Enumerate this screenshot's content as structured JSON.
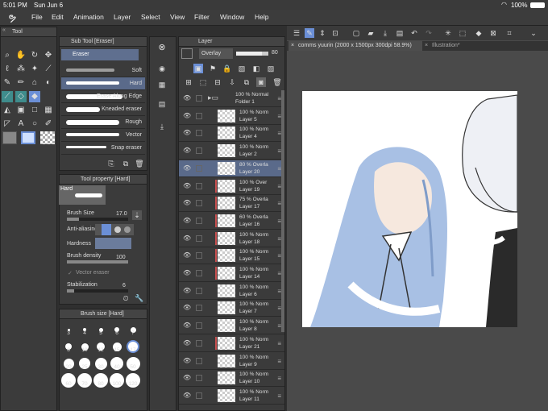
{
  "status": {
    "time": "5:01 PM",
    "date": "Sun Jun 6",
    "battery": "100%"
  },
  "menu": [
    "File",
    "Edit",
    "Animation",
    "Layer",
    "Select",
    "View",
    "Filter",
    "Window",
    "Help"
  ],
  "tool_panel": {
    "title": "Tool"
  },
  "subtool_panel": {
    "title": "Sub Tool [Eraser]",
    "group": "Eraser",
    "items": [
      "Soft",
      "Hard",
      "Erase Along Edge",
      "Kneaded eraser",
      "Rough",
      "Vector",
      "Snap eraser"
    ],
    "selected": "Hard"
  },
  "tool_property": {
    "title": "Tool property [Hard]",
    "preset": "Hard",
    "brush_size_label": "Brush Size",
    "brush_size": "17.0",
    "antialias_label": "Anti-aliasing",
    "hardness_label": "Hardness",
    "density_label": "Brush density",
    "density": "100",
    "vector_eraser_label": "Vector eraser",
    "stabilization_label": "Stabilization",
    "stabilization": "6"
  },
  "brush_size_panel": {
    "title": "Brush size [Hard]",
    "sizes": [
      "3",
      "4",
      "5",
      "6",
      "7",
      "8",
      "10",
      "12",
      "15",
      "17",
      "20",
      "25",
      "30",
      "40",
      "50",
      "60",
      "70",
      "80",
      "100",
      "120"
    ],
    "selected": "17"
  },
  "layer_panel": {
    "title": "Layer",
    "blend_mode": "Overlay",
    "opacity": "80",
    "layers": [
      {
        "mode": "100 % Normal",
        "name": "Folder 1",
        "folder": true
      },
      {
        "mode": "100 % Norm",
        "name": "Layer 5"
      },
      {
        "mode": "100 % Norm",
        "name": "Layer 4"
      },
      {
        "mode": "100 % Norm",
        "name": "Layer 2"
      },
      {
        "mode": "80 % Overla",
        "name": "Layer 20",
        "selected": true
      },
      {
        "mode": "100 % Over",
        "name": "Layer 19",
        "clip": true
      },
      {
        "mode": "75 % Overla",
        "name": "Layer 17",
        "clip": true
      },
      {
        "mode": "60 % Overla",
        "name": "Layer 16",
        "clip": true
      },
      {
        "mode": "100 % Norm",
        "name": "Layer 18",
        "clip": true
      },
      {
        "mode": "100 % Norm",
        "name": "Layer 15",
        "clip": true
      },
      {
        "mode": "100 % Norm",
        "name": "Layer 14",
        "clip": true
      },
      {
        "mode": "100 % Norm",
        "name": "Layer 6"
      },
      {
        "mode": "100 % Norm",
        "name": "Layer 7"
      },
      {
        "mode": "100 % Norm",
        "name": "Layer 8"
      },
      {
        "mode": "100 % Norm",
        "name": "Layer 21",
        "clip": true
      },
      {
        "mode": "100 % Norm",
        "name": "Layer 9"
      },
      {
        "mode": "100 % Norm",
        "name": "Layer 10"
      },
      {
        "mode": "100 % Norm",
        "name": "Layer 11"
      }
    ]
  },
  "canvas_tabs": [
    "comms yuurin (2000 x 1500px 300dpi 58.9%)",
    "Illustration*"
  ],
  "colors": {
    "accent": "#6b8fd6",
    "selected_layer": "#5a6a8a",
    "clip": "#c85050"
  }
}
